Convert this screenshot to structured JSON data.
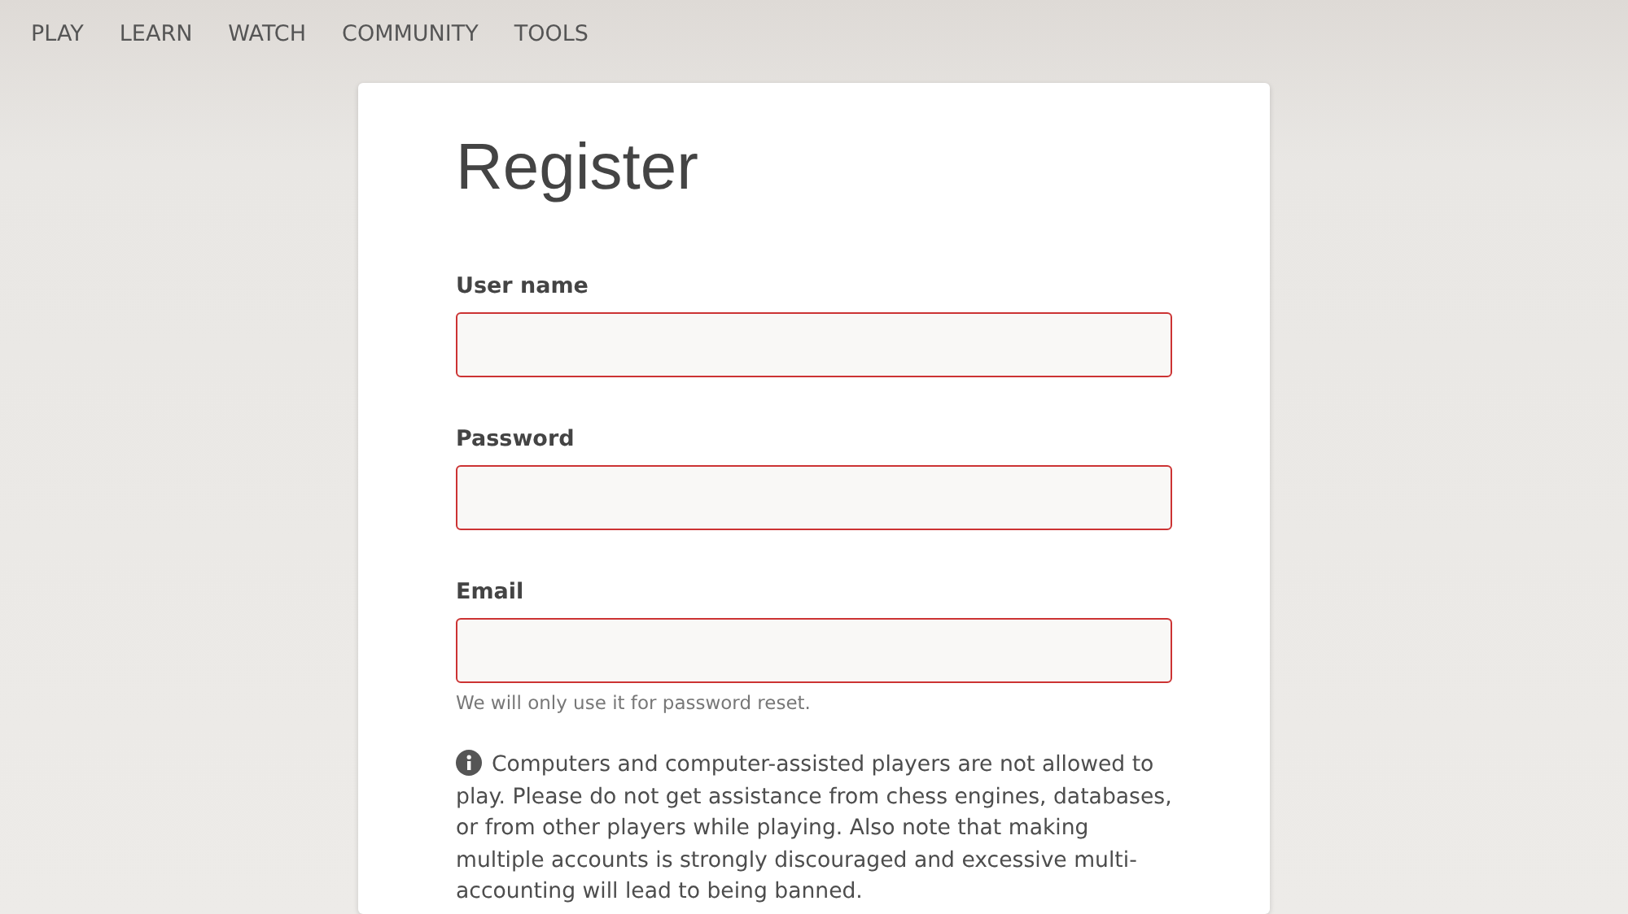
{
  "nav": {
    "items": [
      {
        "label": "PLAY"
      },
      {
        "label": "LEARN"
      },
      {
        "label": "WATCH"
      },
      {
        "label": "COMMUNITY"
      },
      {
        "label": "TOOLS"
      }
    ]
  },
  "form": {
    "title": "Register",
    "fields": [
      {
        "label": "User name",
        "invalid": true
      },
      {
        "label": "Password",
        "invalid": true
      },
      {
        "label": "Email",
        "invalid": true,
        "help": "We will only use it for password reset."
      }
    ],
    "notice": "Computers and computer-assisted players are not allowed to play. Please do not get assistance from chess engines, databases, or from other players while playing. Also note that making multiple accounts is strongly discouraged and excessive multi-accounting will lead to being banned."
  }
}
